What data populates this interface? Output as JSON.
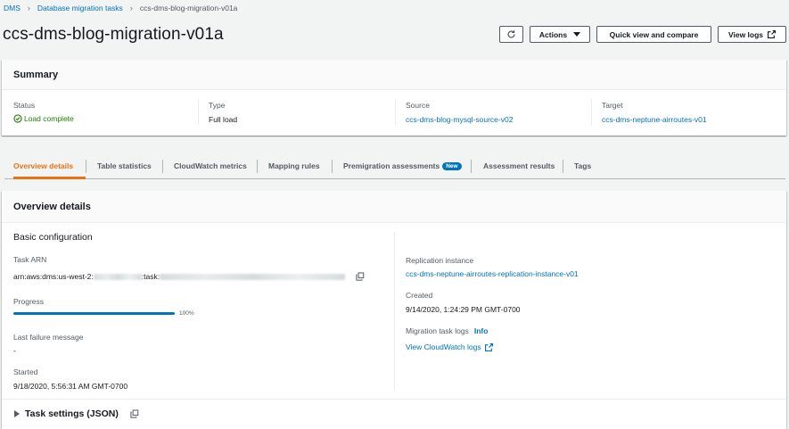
{
  "breadcrumb": {
    "root": "DMS",
    "parent": "Database migration tasks",
    "current": "ccs-dms-blog-migration-v01a"
  },
  "page": {
    "title": "ccs-dms-blog-migration-v01a"
  },
  "toolbar": {
    "actions_label": "Actions",
    "quick_view_label": "Quick view and compare",
    "view_logs_label": "View logs"
  },
  "summary": {
    "title": "Summary",
    "status_label": "Status",
    "status_value": "Load complete",
    "type_label": "Type",
    "type_value": "Full load",
    "source_label": "Source",
    "source_value": "ccs-dms-blog-mysql-source-v02",
    "target_label": "Target",
    "target_value": "ccs-dms-neptune-airroutes-v01"
  },
  "tabs": [
    {
      "label": "Overview details",
      "active": true
    },
    {
      "label": "Table statistics"
    },
    {
      "label": "CloudWatch metrics"
    },
    {
      "label": "Mapping rules"
    },
    {
      "label": "Premigration assessments",
      "badge": "New"
    },
    {
      "label": "Assessment results"
    },
    {
      "label": "Tags"
    }
  ],
  "overview": {
    "title": "Overview details",
    "basic_config_title": "Basic configuration",
    "task_arn_label": "Task ARN",
    "task_arn_prefix": "arn:aws:dms:us-west-2:",
    "task_arn_middle": ":task:",
    "progress_label": "Progress",
    "progress_percent": 100,
    "progress_text": "100%",
    "last_failure_label": "Last failure message",
    "last_failure_value": "-",
    "started_label": "Started",
    "started_value": "9/18/2020, 5:56:31 AM GMT-0700",
    "replication_instance_label": "Replication instance",
    "replication_instance_value": "ccs-dms-neptune-airroutes-replication-instance-v01",
    "created_label": "Created",
    "created_value": "9/14/2020, 1:24:29 PM GMT-0700",
    "migration_logs_label": "Migration task logs",
    "info_label": "Info",
    "cloudwatch_logs_label": "View CloudWatch logs",
    "task_settings_label": "Task settings (JSON)"
  },
  "colors": {
    "link": "#0073bb",
    "success": "#1d8102",
    "active_tab": "#ec7211",
    "progress": "#0073bb"
  },
  "icons": {
    "refresh": "refresh-icon",
    "caret": "caret-down-icon",
    "external": "external-link-icon",
    "copy": "copy-icon",
    "status": "success-circle-icon",
    "expand": "caret-right-icon"
  }
}
